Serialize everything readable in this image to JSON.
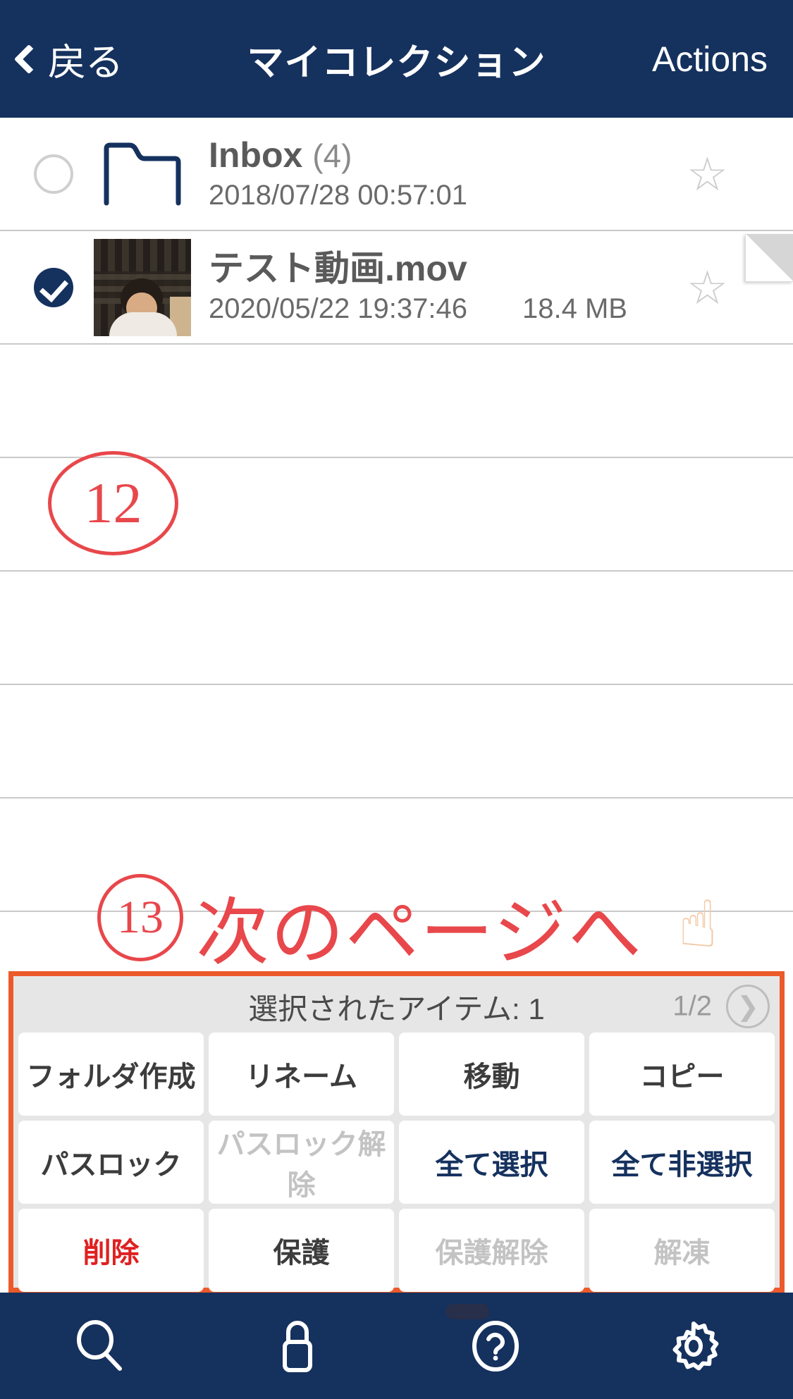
{
  "navbar": {
    "back_label": "戻る",
    "back_icon": "chevron-left-icon",
    "title": "マイコレクション",
    "actions_label": "Actions"
  },
  "list": {
    "rows": [
      {
        "kind": "folder",
        "checked": false,
        "title": "Inbox",
        "count": "(4)",
        "date": "2018/07/28 00:57:01",
        "size": "",
        "star": "☆",
        "dogear": false
      },
      {
        "kind": "video",
        "checked": true,
        "title": "テスト動画.mov",
        "count": "",
        "date": "2020/05/22 19:37:46",
        "size": "18.4 MB",
        "star": "☆",
        "dogear": true
      }
    ]
  },
  "annotations": {
    "marker12": "12",
    "marker13": "13",
    "next_page_text": "次のページへ",
    "hand_icon": "pointing-up-hand-icon",
    "hand_glyph": "☝",
    "color": "#e8474b",
    "panel_outline_color": "#ec5a2b"
  },
  "action_panel": {
    "selected_label": "選択されたアイテム: 1",
    "page_indicator": "1/2",
    "next_icon": "chevron-right-icon",
    "next_glyph": "❯",
    "buttons": [
      {
        "label": "フォルダ作成",
        "state": "enabled"
      },
      {
        "label": "リネーム",
        "state": "enabled"
      },
      {
        "label": "移動",
        "state": "enabled"
      },
      {
        "label": "コピー",
        "state": "enabled"
      },
      {
        "label": "パスロック",
        "state": "enabled"
      },
      {
        "label": "パスロック解除",
        "state": "disabled"
      },
      {
        "label": "全て選択",
        "state": "navy"
      },
      {
        "label": "全て非選択",
        "state": "navy"
      },
      {
        "label": "削除",
        "state": "danger"
      },
      {
        "label": "保護",
        "state": "enabled"
      },
      {
        "label": "保護解除",
        "state": "disabled"
      },
      {
        "label": "解凍",
        "state": "disabled"
      }
    ]
  },
  "tabbar": {
    "items": [
      {
        "icon": "search-icon"
      },
      {
        "icon": "lock-icon"
      },
      {
        "icon": "help-circle-icon"
      },
      {
        "icon": "gear-icon"
      }
    ]
  },
  "colors": {
    "navy": "#15315e",
    "annotation_red": "#e8474b",
    "panel_border_orange": "#ec5a2b",
    "danger_red": "#e02020",
    "panel_bg": "#e6e6e6"
  }
}
